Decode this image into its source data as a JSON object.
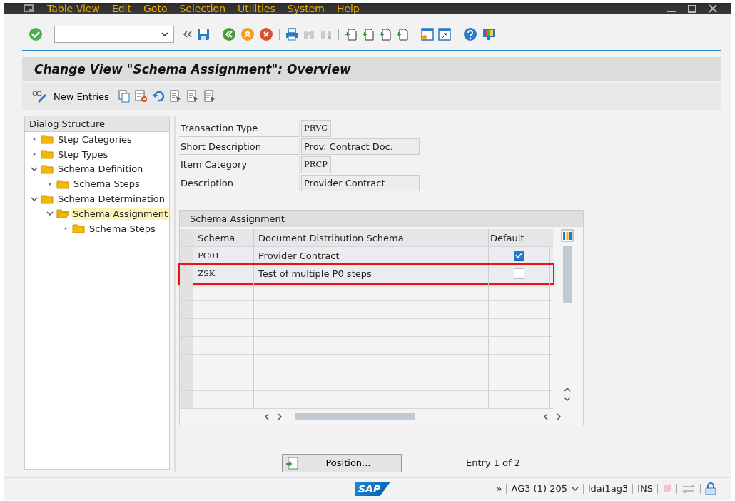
{
  "menu": [
    "Table View",
    "Edit",
    "Goto",
    "Selection",
    "Utilities",
    "System",
    "Help"
  ],
  "title": "Change View \"Schema Assignment\": Overview",
  "app_toolbar": {
    "new_entries": "New Entries"
  },
  "dialog_structure": {
    "title": "Dialog Structure",
    "items": [
      {
        "label": "Step Categories",
        "expanded": false,
        "selected": false
      },
      {
        "label": "Step Types",
        "expanded": false,
        "selected": false
      },
      {
        "label": "Schema Definition",
        "expanded": true,
        "selected": false,
        "children": [
          {
            "label": "Schema Steps",
            "expanded": false,
            "selected": false
          }
        ]
      },
      {
        "label": "Schema Determination",
        "expanded": true,
        "selected": false,
        "children": [
          {
            "label": "Schema Assignment",
            "expanded": true,
            "selected": true,
            "children": [
              {
                "label": "Schema Steps",
                "expanded": false,
                "selected": false
              }
            ]
          }
        ]
      }
    ]
  },
  "header_fields": [
    {
      "label": "Transaction Type",
      "value": "PRVC",
      "kind": "code"
    },
    {
      "label": "Short Description",
      "value": "Prov. Contract Doc.",
      "kind": "text"
    },
    {
      "label": "Item Category",
      "value": "PRCP",
      "kind": "code"
    },
    {
      "label": "Description",
      "value": "Provider Contract",
      "kind": "text"
    }
  ],
  "table": {
    "title": "Schema Assignment",
    "columns": [
      "Schema",
      "Document Distribution Schema",
      "Default"
    ],
    "rows": [
      {
        "schema": "PC01",
        "description": "Provider Contract",
        "default": true,
        "highlighted": false
      },
      {
        "schema": "ZSK",
        "description": "Test of multiple P0 steps",
        "default": false,
        "highlighted": true
      }
    ]
  },
  "position_button": "Position...",
  "entry_info": "Entry 1 of 2",
  "status_bar": {
    "logo": "SAP",
    "expand": "»",
    "system": "AG3 (1) 205",
    "server": "ldai1ag3",
    "mode": "INS"
  }
}
